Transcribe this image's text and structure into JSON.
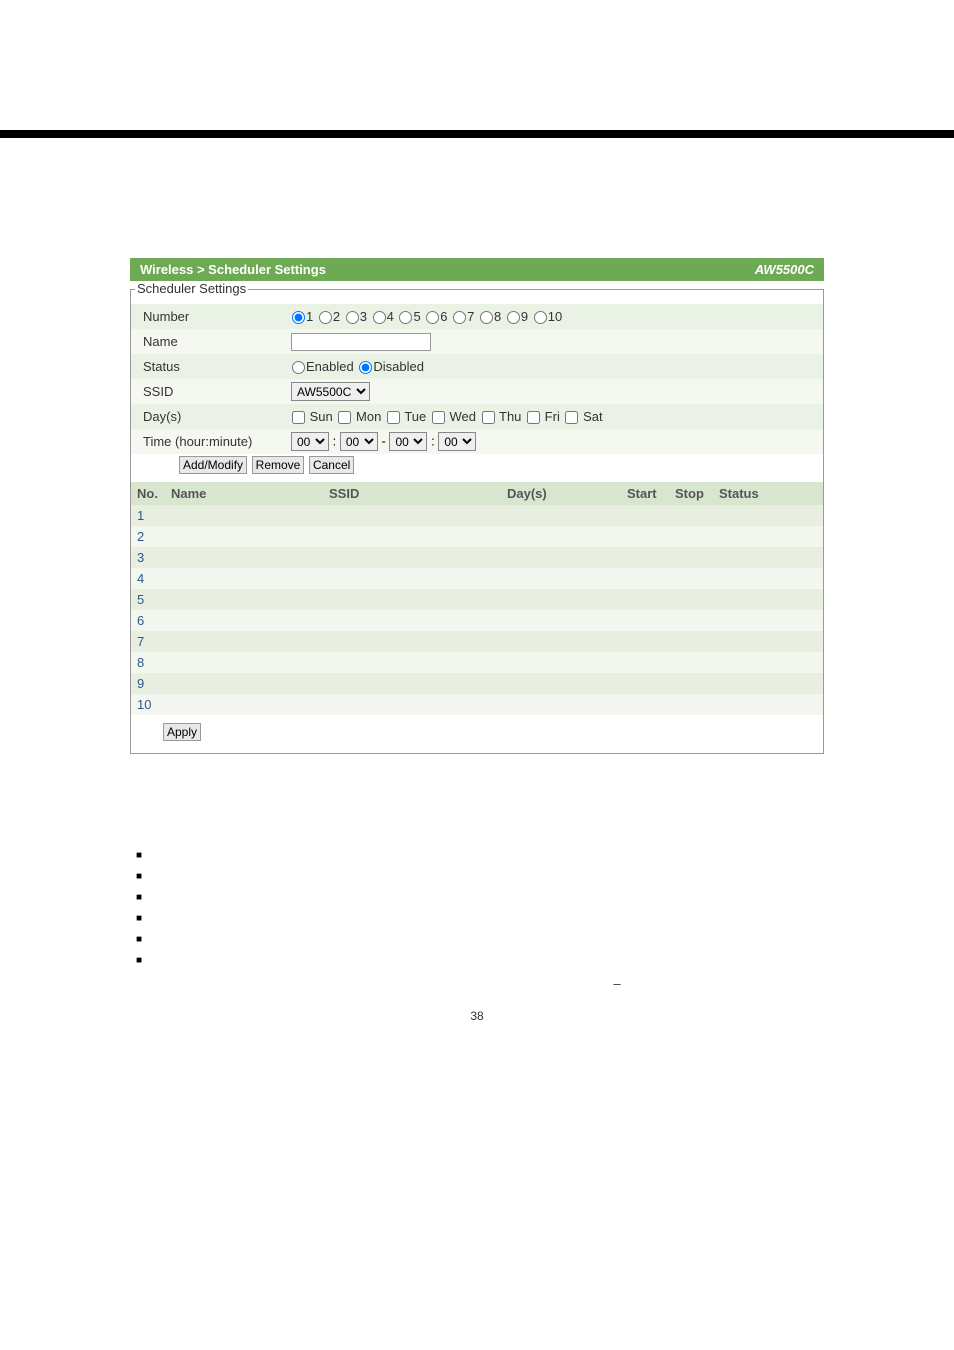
{
  "header": {
    "breadcrumb": "Wireless > Scheduler Settings",
    "model": "AW5500C"
  },
  "legend": "Scheduler Settings",
  "form": {
    "number_label": "Number",
    "numbers": [
      "1",
      "2",
      "3",
      "4",
      "5",
      "6",
      "7",
      "8",
      "9",
      "10"
    ],
    "number_selected": "1",
    "name_label": "Name",
    "name_value": "",
    "status_label": "Status",
    "status_enabled": "Enabled",
    "status_disabled": "Disabled",
    "ssid_label": "SSID",
    "ssid_value": "AW5500C",
    "days_label": "Day(s)",
    "days": [
      "Sun",
      "Mon",
      "Tue",
      "Wed",
      "Thu",
      "Fri",
      "Sat"
    ],
    "time_label": "Time (hour:minute)",
    "time_h1": "00",
    "time_m1": "00",
    "time_h2": "00",
    "time_m2": "00",
    "colon": ":",
    "dash": "-",
    "btn_addmodify": "Add/Modify",
    "btn_remove": "Remove",
    "btn_cancel": "Cancel"
  },
  "table": {
    "headers": {
      "no": "No.",
      "name": "Name",
      "ssid": "SSID",
      "days": "Day(s)",
      "start": "Start",
      "stop": "Stop",
      "status": "Status"
    },
    "rows": [
      {
        "no": "1",
        "name": "",
        "ssid": "",
        "days": "",
        "start": "",
        "stop": "",
        "status": ""
      },
      {
        "no": "2",
        "name": "",
        "ssid": "",
        "days": "",
        "start": "",
        "stop": "",
        "status": ""
      },
      {
        "no": "3",
        "name": "",
        "ssid": "",
        "days": "",
        "start": "",
        "stop": "",
        "status": ""
      },
      {
        "no": "4",
        "name": "",
        "ssid": "",
        "days": "",
        "start": "",
        "stop": "",
        "status": ""
      },
      {
        "no": "5",
        "name": "",
        "ssid": "",
        "days": "",
        "start": "",
        "stop": "",
        "status": ""
      },
      {
        "no": "6",
        "name": "",
        "ssid": "",
        "days": "",
        "start": "",
        "stop": "",
        "status": ""
      },
      {
        "no": "7",
        "name": "",
        "ssid": "",
        "days": "",
        "start": "",
        "stop": "",
        "status": ""
      },
      {
        "no": "8",
        "name": "",
        "ssid": "",
        "days": "",
        "start": "",
        "stop": "",
        "status": ""
      },
      {
        "no": "9",
        "name": "",
        "ssid": "",
        "days": "",
        "start": "",
        "stop": "",
        "status": ""
      },
      {
        "no": "10",
        "name": "",
        "ssid": "",
        "days": "",
        "start": "",
        "stop": "",
        "status": ""
      }
    ]
  },
  "btn_apply": "Apply",
  "dash": "–",
  "page_number": "38"
}
